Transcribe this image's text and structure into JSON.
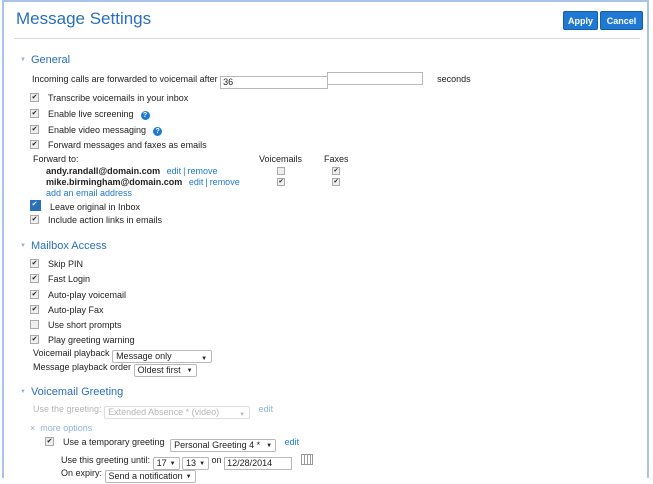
{
  "header": {
    "title": "Message Settings",
    "apply_label": "Apply",
    "cancel_label": "Cancel"
  },
  "general": {
    "title": "General",
    "forward_prefix": "Incoming calls are forwarded to voicemail after",
    "forward_value": "36",
    "forward_suffix": "seconds",
    "transcribe": "Transcribe voicemails in your inbox",
    "live_screening": "Enable live screening",
    "video_messaging": "Enable video messaging",
    "forward_emails": "Forward messages and faxes as emails",
    "forward_to_label": "Forward to:",
    "col_voicemails": "Voicemails",
    "col_faxes": "Faxes",
    "recipients": [
      {
        "email": "andy.randall@domain.com",
        "edit": "edit",
        "sep": "|",
        "remove": "remove",
        "voicemails": false,
        "faxes": true
      },
      {
        "email": "mike.birmingham@domain.com",
        "edit": "edit",
        "sep": "|",
        "remove": "remove",
        "voicemails": true,
        "faxes": true
      }
    ],
    "add_email": "add an email address",
    "leave_original": "Leave original in Inbox",
    "include_links": "Include action links in emails"
  },
  "mailbox": {
    "title": "Mailbox Access",
    "skip_pin": "Skip PIN",
    "fast_login": "Fast Login",
    "autoplay_voicemail": "Auto-play voicemail",
    "autoplay_fax": "Auto-play Fax",
    "short_prompts": "Use short prompts",
    "greeting_warning": "Play greeting warning",
    "playback_label": "Voicemail playback",
    "playback_value": "Message only",
    "order_label": "Message playback order",
    "order_value": "Oldest first"
  },
  "greeting": {
    "title": "Voicemail Greeting",
    "use_label": "Use the greeting:",
    "use_value": "Extended Absence * (video)",
    "use_edit": "edit",
    "more_options": "more options",
    "temp_label": "Use a temporary greeting",
    "temp_value": "Personal Greeting 4 *",
    "temp_edit": "edit",
    "until_label": "Use this greeting until:",
    "until_hour": "17",
    "until_min": "13",
    "on_label": "on",
    "until_date": "12/28/2014",
    "expiry_label": "On expiry:",
    "expiry_value": "Send a notification"
  }
}
